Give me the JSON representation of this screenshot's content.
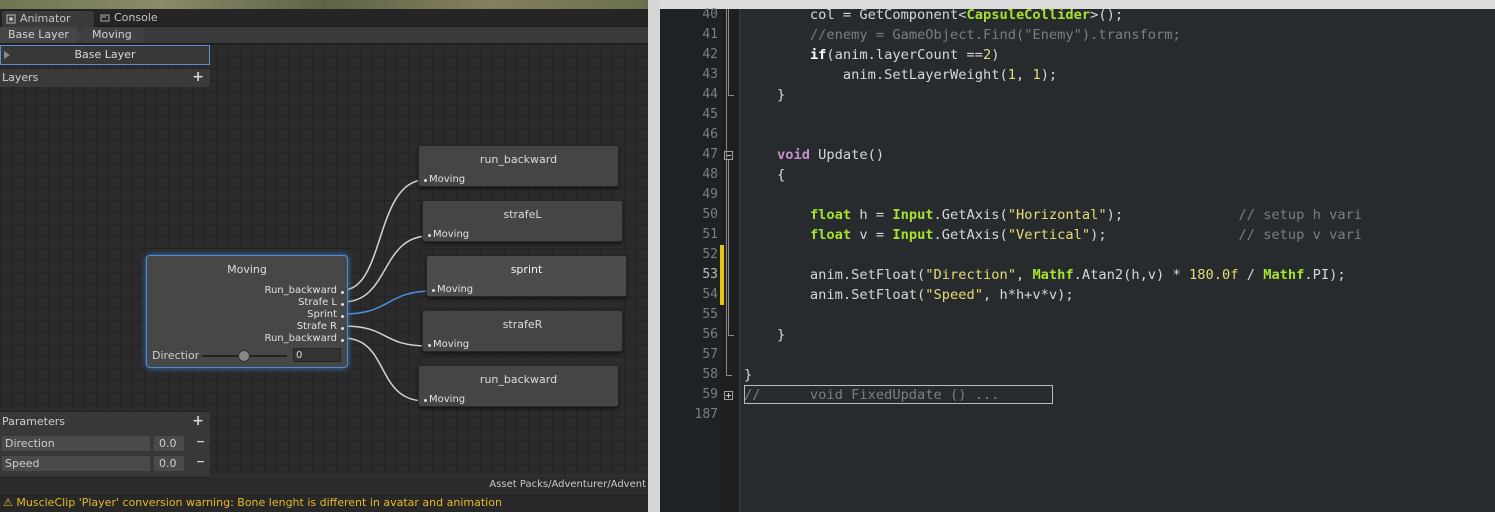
{
  "animator": {
    "tabs": [
      {
        "label": "Animator",
        "icon": "animator-icon"
      },
      {
        "label": "Console",
        "icon": "console-icon"
      }
    ],
    "breadcrumb": [
      "Base Layer",
      "Moving"
    ],
    "layer_select": "Base Layer",
    "layers_title": "Layers",
    "main_node": {
      "title": "Moving",
      "outputs": [
        "Run_backward",
        "Strafe L",
        "Sprint",
        "Strafe R",
        "Run_backward"
      ],
      "param_label": "Direction",
      "param_value": "0",
      "slider_value": 0.5
    },
    "nodes": [
      {
        "title": "run_backward",
        "input": "Moving"
      },
      {
        "title": "strafeL",
        "input": "Moving"
      },
      {
        "title": "sprint",
        "input": "Moving"
      },
      {
        "title": "strafeR",
        "input": "Moving"
      },
      {
        "title": "run_backward",
        "input": "Moving"
      }
    ],
    "parameters_title": "Parameters",
    "parameters": [
      {
        "name": "Direction",
        "value": "0.0"
      },
      {
        "name": "Speed",
        "value": "0.0"
      }
    ],
    "asset_path": "Asset Packs/Adventurer/Advent",
    "status": "MuscleClip 'Player' conversion warning: Bone lenght is different in avatar and animation",
    "colors": {
      "selected": "#4a90d9",
      "warning": "#e8b928",
      "active_link": "#4a90d9"
    }
  },
  "editor": {
    "line_numbers": [
      "40",
      "41",
      "42",
      "43",
      "44",
      "45",
      "46",
      "47",
      "48",
      "49",
      "50",
      "51",
      "52",
      "53",
      "54",
      "55",
      "56",
      "57",
      "58",
      "59",
      "187"
    ],
    "modified_lines": [
      "52",
      "53",
      "54"
    ],
    "colors": {
      "keyword": "#c58fcf",
      "type": "#a6e22e",
      "string": "#e6db74",
      "comment": "#7a7e83"
    }
  }
}
